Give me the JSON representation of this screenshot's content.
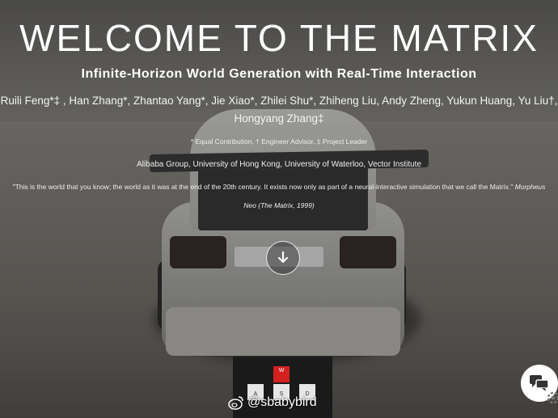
{
  "page": {
    "title": "WELCOME TO THE MATRIX",
    "subtitle": "Infinite-Horizon World Generation with Real-Time Interaction",
    "authors_line1": "Ruili Feng*‡ , Han Zhang*, Zhantao Yang*, Jie Xiao*, Zhilei Shu*, Zhiheng Liu, Andy Zheng, Yukun Huang, Yu Liu†,",
    "authors_line2": "Hongyang Zhang‡",
    "contribution_note": "* Equal Contribution, † Engineer Advisor, ‡ Project Leader",
    "institutions": "Alibaba Group, University of Hong Kong, University of Waterloo, Vector Institute",
    "quote_text": "\"This is the world that you know; the world as it was at the end of the 20th century. It exists now only as part of a neural-interactive simulation that we call the Matrix.\"",
    "quote_speaker": "Morpheus",
    "quote_source": "Neo (The Matrix, 1999)"
  },
  "controls": {
    "keys": {
      "w": "W",
      "a": "A",
      "s": "S",
      "d": "D"
    },
    "active_key": "W",
    "active_color": "#d52020"
  },
  "watermark": {
    "text": "@sbabybird",
    "icon": "weibo-icon"
  },
  "icons": {
    "scroll": "arrow-down-icon",
    "chat": "chat-bubbles-icon",
    "settings": "gear-icon"
  }
}
